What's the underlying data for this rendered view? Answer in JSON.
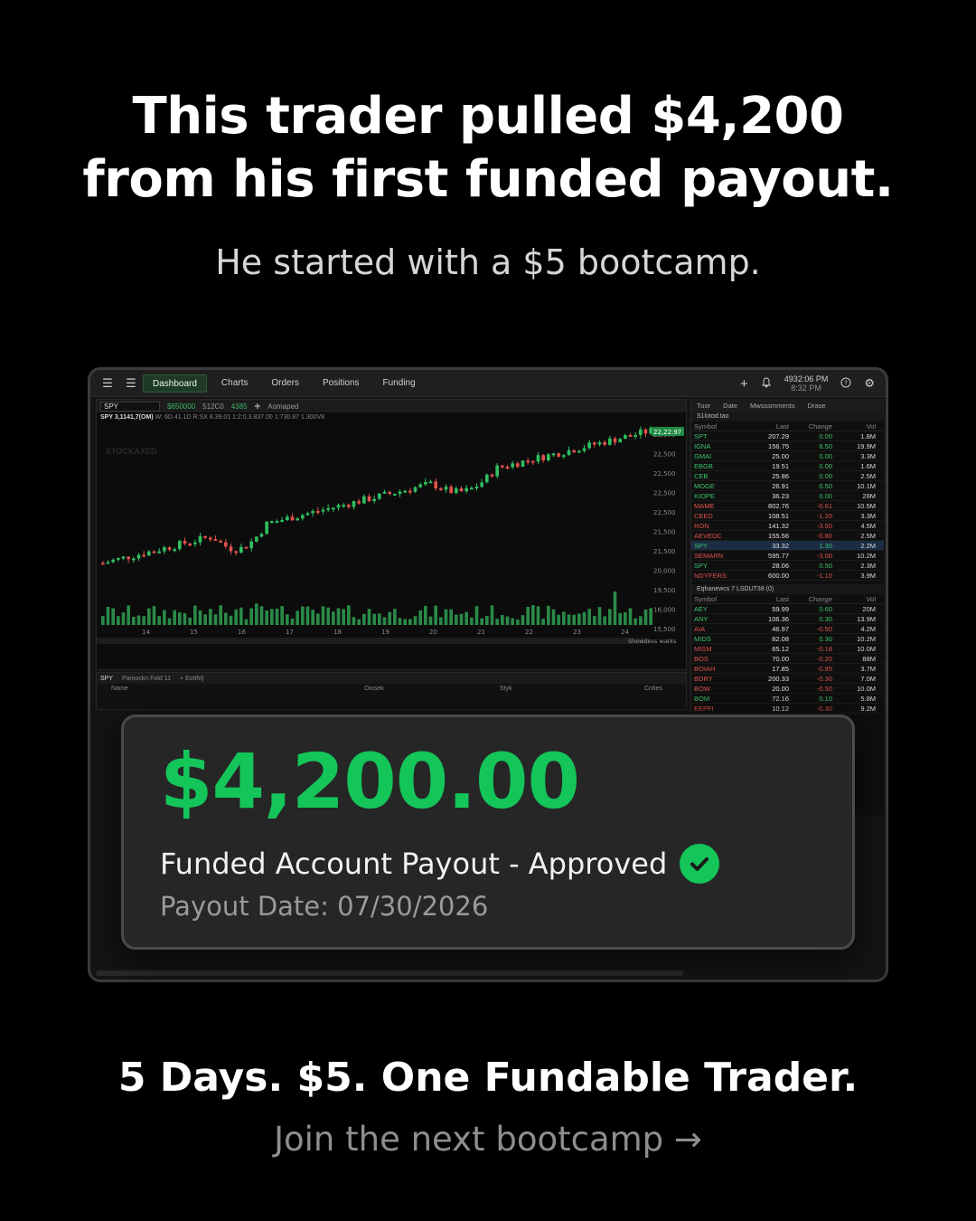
{
  "headline": {
    "line1": "This trader pulled $4,200",
    "line2": "from his first funded payout."
  },
  "subhead": "He started with a $5 bootcamp.",
  "platform": {
    "nav": [
      "Dashboard",
      "Charts",
      "Orders",
      "Positions",
      "Funding"
    ],
    "active_nav": "Dashboard",
    "clock_time": "4932:06 PM",
    "clock_sub": "8:32 PM",
    "chart": {
      "symbol": "SPY",
      "toolbar": [
        "$650000",
        "512C0",
        "4385"
      ],
      "toolbar_mode": "Aomaped",
      "info_symbol": "SPY 3,1141,7(OM)",
      "info_values": "W: 6D.41.1D  R:SX  8.39.01  1:2:0.3.837.00  1:730.87  1.300V8",
      "watermark": "STOCKAXED",
      "price_labels": [
        "22,600",
        "22,500",
        "22,500",
        "22,500",
        "22,500",
        "21,500",
        "21,500",
        "20,000",
        "19,500",
        "16,000",
        "15,500"
      ],
      "current_price": "22,22.97",
      "date_labels": [
        "14",
        "15",
        "16",
        "17",
        "18",
        "19",
        "20",
        "21",
        "22",
        "23",
        "24"
      ],
      "footer": "Showdess watks"
    },
    "lower_panel": {
      "symbol": "SPY",
      "tabs": [
        "Pamockn Fold 11",
        "+ Eottht)"
      ],
      "columns": [
        "Name",
        "Oiosek",
        "Styk",
        "Cnties"
      ]
    },
    "side": {
      "tabs": [
        "Tuor",
        "Date",
        "Mwsssmments",
        "Drase"
      ],
      "section1": "S1lotod.tao",
      "section2": "Eqhanewcs 7 LSDUT38 (0)",
      "head": {
        "symbol": "Symbol",
        "last": "Last",
        "change": "Change",
        "vol": "Vol"
      },
      "rows1": [
        {
          "s": "SPT",
          "l": "207.29",
          "c": "0.00",
          "v": "1.8M"
        },
        {
          "s": "IGNA",
          "l": "156.75",
          "c": "6.50",
          "v": "19.9M"
        },
        {
          "s": "GMAI",
          "l": "25.00",
          "c": "0.00",
          "v": "3.3M"
        },
        {
          "s": "EBGB",
          "l": "19.51",
          "c": "0.00",
          "v": "1.6M"
        },
        {
          "s": "CEB",
          "l": "25.86",
          "c": "0.00",
          "v": "2.5M"
        },
        {
          "s": "MOGE",
          "l": "26.91",
          "c": "0.50",
          "v": "10.1M"
        },
        {
          "s": "KIOPE",
          "l": "36.23",
          "c": "0.00",
          "v": "28M"
        },
        {
          "s": "MAME",
          "l": "802.76",
          "c": "-0.61",
          "v": "10.5M"
        },
        {
          "s": "CEED",
          "l": "108.51",
          "c": "-1.20",
          "v": "3.3M"
        },
        {
          "s": "RON",
          "l": "141.32",
          "c": "-3.50",
          "v": "4.5M"
        },
        {
          "s": "AEVEDC",
          "l": "155.56",
          "c": "-0.80",
          "v": "2.5M"
        },
        {
          "s": "SPY",
          "l": "33.32",
          "c": "1.30",
          "v": "2.2M"
        },
        {
          "s": "SEMARN",
          "l": "595.77",
          "c": "-3.00",
          "v": "10.2M"
        },
        {
          "s": "SPY",
          "l": "28.06",
          "c": "0.50",
          "v": "2.3M"
        },
        {
          "s": "NDYFERS",
          "l": "600.00",
          "c": "-1.10",
          "v": "3.9M"
        }
      ],
      "rows2": [
        {
          "s": "AEY",
          "l": "59.99",
          "c": "0.60",
          "v": "20M"
        },
        {
          "s": "ANY",
          "l": "106.36",
          "c": "0.30",
          "v": "13.9M"
        },
        {
          "s": "AIA",
          "l": "46.97",
          "c": "-0.50",
          "v": "4.2M"
        },
        {
          "s": "MIDS",
          "l": "82.08",
          "c": "0.30",
          "v": "10.2M"
        },
        {
          "s": "MISM",
          "l": "65.12",
          "c": "-0.18",
          "v": "10.0M"
        },
        {
          "s": "BOS",
          "l": "70.00",
          "c": "-0.20",
          "v": "88M"
        },
        {
          "s": "BOIAH",
          "l": "17.85",
          "c": "-0.85",
          "v": "3.7M"
        },
        {
          "s": "BDRY",
          "l": "200.33",
          "c": "-0.30",
          "v": "7.0M"
        },
        {
          "s": "BOW",
          "l": "20.00",
          "c": "-0.50",
          "v": "10.0M"
        },
        {
          "s": "BOM",
          "l": "72.16",
          "c": "0.10",
          "v": "5.8M"
        },
        {
          "s": "EEPFI",
          "l": "10.12",
          "c": "-0.30",
          "v": "9.2M"
        }
      ]
    }
  },
  "payout": {
    "amount": "$4,200.00",
    "status": "Funded Account Payout - Approved",
    "date": "Payout Date: 07/30/2026"
  },
  "tagline": "5 Days. $5. One Fundable Trader.",
  "cta": "Join the next bootcamp →",
  "colors": {
    "accent_green": "#14c55a",
    "candle_up": "#2fbf5f",
    "candle_down": "#e0524b",
    "background": "#000000"
  }
}
